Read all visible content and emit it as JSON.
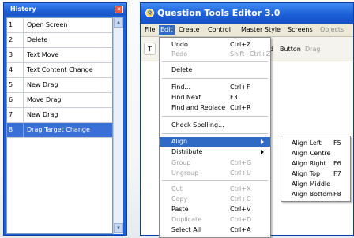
{
  "history": {
    "title": "History",
    "close_glyph": "✕",
    "items": [
      {
        "num": "1",
        "label": "Open Screen"
      },
      {
        "num": "2",
        "label": "Delete"
      },
      {
        "num": "3",
        "label": "Text Move"
      },
      {
        "num": "4",
        "label": "Text Content Change"
      },
      {
        "num": "5",
        "label": "New Drag"
      },
      {
        "num": "6",
        "label": "Move Drag"
      },
      {
        "num": "7",
        "label": "New Drag"
      },
      {
        "num": "8",
        "label": "Drag Target Change",
        "selected": true
      }
    ],
    "scroll_up_icon": "chevron-up-icon",
    "scroll_down_icon": "chevron-down-icon"
  },
  "editor": {
    "title": "Question Tools Editor 3.0",
    "app_icon": "app-logo-icon",
    "menubar": [
      "File",
      "Edit",
      "Create",
      "Control",
      "Master Style",
      "Screens",
      "Objects"
    ],
    "active_menu": "Edit",
    "toolbar": {
      "tab_partial": "T",
      "label_partial": "d",
      "button_label": "Button",
      "drag_label": "Drag"
    }
  },
  "edit_menu": {
    "items": [
      {
        "label": "Undo",
        "shortcut": "Ctrl+Z"
      },
      {
        "label": "Redo",
        "shortcut": "Shift+Ctrl+Z",
        "disabled": true
      },
      {
        "label": "Delete",
        "shortcut": ""
      },
      {
        "label": "Find...",
        "shortcut": "Ctrl+F"
      },
      {
        "label": "Find Next",
        "shortcut": "F3"
      },
      {
        "label": "Find and Replace",
        "shortcut": "Ctrl+R"
      },
      {
        "label": "Check Spelling...",
        "shortcut": ""
      },
      {
        "label": "Align",
        "shortcut": "",
        "submenu": true,
        "highlighted": true
      },
      {
        "label": "Distribute",
        "shortcut": "",
        "submenu": true
      },
      {
        "label": "Group",
        "shortcut": "Ctrl+G",
        "disabled": true
      },
      {
        "label": "Ungroup",
        "shortcut": "Ctrl+U",
        "disabled": true
      },
      {
        "label": "Cut",
        "shortcut": "Ctrl+X",
        "disabled": true
      },
      {
        "label": "Copy",
        "shortcut": "Ctrl+C",
        "disabled": true
      },
      {
        "label": "Paste",
        "shortcut": "Ctrl+V"
      },
      {
        "label": "Duplicate",
        "shortcut": "Ctrl+D",
        "disabled": true
      },
      {
        "label": "Select All",
        "shortcut": "Ctrl+A"
      }
    ]
  },
  "align_submenu": {
    "items": [
      {
        "label": "Align Left",
        "shortcut": "F5"
      },
      {
        "label": "Align Centre",
        "shortcut": ""
      },
      {
        "label": "Align Right",
        "shortcut": "F6"
      },
      {
        "label": "Align Top",
        "shortcut": "F7"
      },
      {
        "label": "Align Middle",
        "shortcut": ""
      },
      {
        "label": "Align Bottom",
        "shortcut": "F8"
      }
    ]
  },
  "colors": {
    "titlebar_blue": "#1d5fd9",
    "selection_blue": "#316ac5",
    "menubar_bg": "#ece9d8",
    "disabled_text": "#a0a0a0"
  }
}
